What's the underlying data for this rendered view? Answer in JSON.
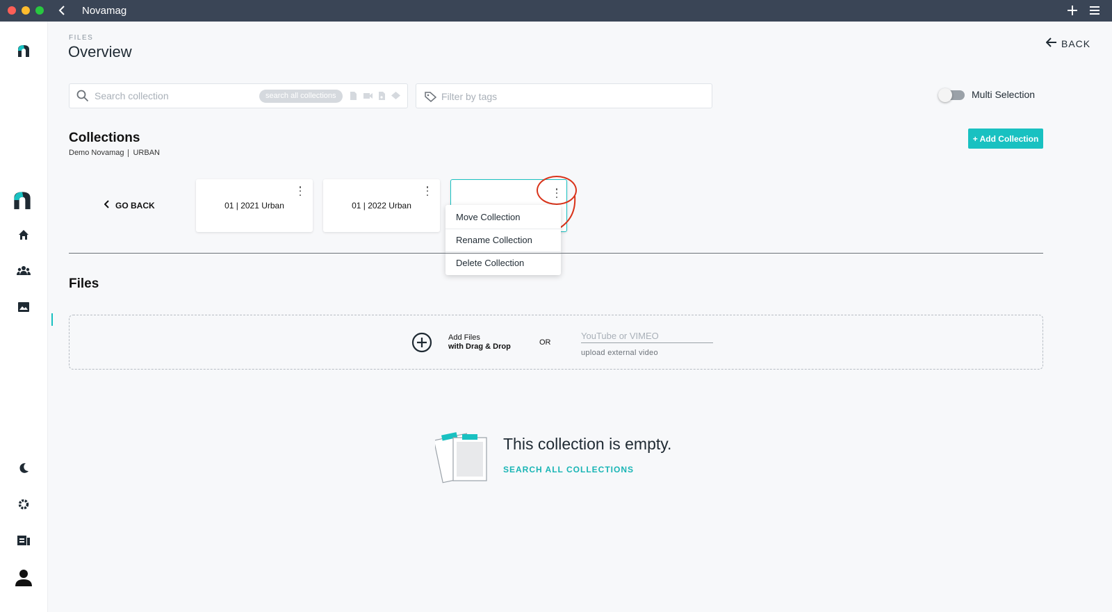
{
  "app": {
    "title": "Novamag"
  },
  "header": {
    "eyebrow": "FILES",
    "title": "Overview",
    "back_label": "BACK"
  },
  "search": {
    "placeholder": "Search collection",
    "search_all_pill": "search all collections",
    "tag_placeholder": "Filter by tags"
  },
  "multi_selection": {
    "label": "Multi Selection",
    "enabled": false
  },
  "collections": {
    "title": "Collections",
    "breadcrumb": [
      "Demo Novamag",
      "URBAN"
    ],
    "add_button": "+ Add Collection",
    "go_back": "GO BACK",
    "cards": [
      {
        "label": "01 | 2021 Urban"
      },
      {
        "label": "01 | 2022 Urban"
      }
    ]
  },
  "context_menu": {
    "items": [
      "Move Collection",
      "Rename Collection",
      "Delete Collection"
    ]
  },
  "files": {
    "title": "Files",
    "add_line1": "Add Files",
    "add_line2": "with Drag & Drop",
    "or": "OR",
    "video_placeholder": "YouTube or VIMEO",
    "video_hint": "upload external video"
  },
  "empty_state": {
    "title": "This collection is empty.",
    "link": "SEARCH ALL COLLECTIONS"
  },
  "colors": {
    "accent": "#19c1c1",
    "titlebar": "#3a4556",
    "annotation": "#d9331a"
  },
  "icons": [
    "chevron-left-icon",
    "plus-icon",
    "menu-icon",
    "logo-icon",
    "home-icon",
    "users-icon",
    "image-icon",
    "moon-icon",
    "gear-icon",
    "magazine-icon",
    "profile-icon",
    "search-icon",
    "tag-icon",
    "kebab-icon",
    "add-circle-icon",
    "arrow-left-icon"
  ]
}
